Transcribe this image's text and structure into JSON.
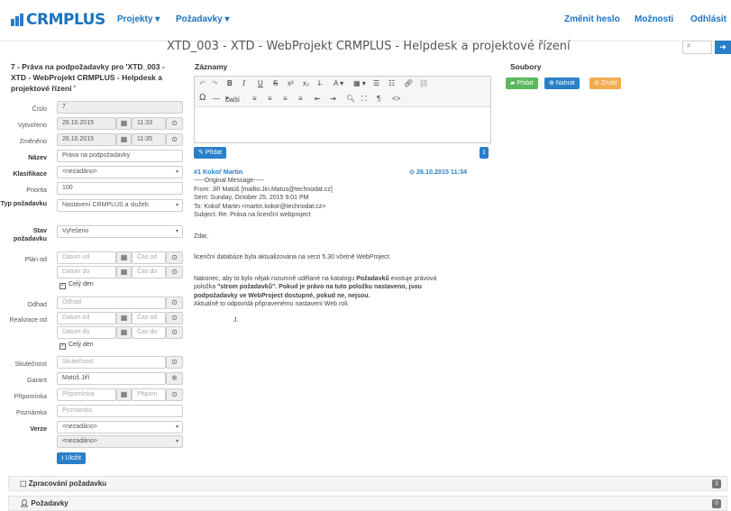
{
  "nav": {
    "logo_text": "CRMPLUS",
    "projekty": "Projekty",
    "pozadavky": "Požadavky",
    "zmenit_heslo": "Změnit heslo",
    "moznosti": "Možnosti",
    "odhlasit": "Odhlásit"
  },
  "page_title": "XTD_003 - XTD - WebProjekt CRMPLUS - Helpdesk a projektové řízení",
  "search": {
    "placeholder": "#"
  },
  "form": {
    "title": "7 - Práva na podpožadavky pro 'XTD_003 - XTD - WebProjekt CRMPLUS - Helpdesk a projektové řízení '",
    "cislo_label": "Číslo",
    "cislo_value": "7",
    "vytvoreno_label": "Vytvořeno",
    "vytvoreno_date": "26.10.2015",
    "vytvoreno_time": "11:33",
    "zmeneno_label": "Změněno",
    "zmeneno_date": "26.10.2015",
    "zmeneno_time": "11:35",
    "nazev_label": "Název",
    "nazev_value": "Práva na podpožadavky",
    "klasifikace_label": "Klasifikace",
    "klasifikace_value": "<nezadáno>",
    "priorita_label": "Priorita",
    "priorita_value": "100",
    "typ_label": "Typ požadavku",
    "typ_value": "Nastavení CRMPLUS a služeb",
    "stav_label": "Stav požadavku",
    "stav_value": "Vyřešeno",
    "plan_label": "Plán od",
    "datum_od": "Datum od",
    "datum_do": "Datum do",
    "cas_od": "Čas od",
    "cas_do": "Čas do",
    "cely_den": "Celý den",
    "odhad_label": "Odhad",
    "odhad_placeholder": "Odhad",
    "realizace_label": "Realizace od",
    "skutecnost_label": "Skutečnost",
    "skutecnost_placeholder": "Skutečnost",
    "garant_label": "Garant",
    "garant_value": "Matúš Jiří",
    "pripominka_label": "Připomínka",
    "pripominka_placeholder": "Připomínka",
    "pripominka_time_placeholder": "Připom",
    "poznamka_label": "Poznámka",
    "poznamka_placeholder": "Poznámka",
    "verze_label": "Verze",
    "verze_value1": "<nezadáno>",
    "verze_value2": "<nezadáno>",
    "ulozit": "Uložit"
  },
  "zaznamy": {
    "heading": "Záznamy",
    "dalsi": "Další",
    "pridat": "Přidat",
    "count_badge": "1",
    "record_author": "#1  Kokoř Martin",
    "record_date": "26.10.2015 11:34",
    "mail_lines": [
      "-----Original Message-----",
      "From: Jiří Matúš [mailto:Jiri.Matus@technodat.cz]",
      "Sent: Sunday, October 25, 2015 9:01 PM",
      "To: Kokoř Martin <martin.kokor@technodat.cz>",
      "Subject: Re: Práva na licenční webproject"
    ],
    "greeting": "Zdar,",
    "para1": "licenční databáze byla aktualizována na verzi 5.30 včetně WebProject.",
    "para2_a": "Nakonec, aby to bylo nějak rozumně udělané na katalogu ",
    "para2_b": "Požadavků",
    "para2_c": " existuje právová",
    "para3_a": "položka ",
    "para3_b": "\"strom požadavků\". Pokud je právo na tuto položku nastaveno, jsou",
    "para4": "podpožadavky ve WebProject dostupné, pokud ne, nejsou.",
    "para5": "Aktuálně to odpovídá připravenému nastavení Web roli.",
    "sign": "J."
  },
  "soubory": {
    "heading": "Soubory",
    "pridat": "Přidat",
    "nahrat": "Nahrát",
    "zrusit": "Zrušit"
  },
  "panels": {
    "zpracovani": "Zpracování požadavku",
    "zpracovani_count": "1",
    "pozadavky": "Požadavky",
    "pozadavky_count": "0"
  },
  "colors": {
    "accent": "#2a7fc9",
    "success": "#5cb85c",
    "warning": "#f0ad4e"
  }
}
